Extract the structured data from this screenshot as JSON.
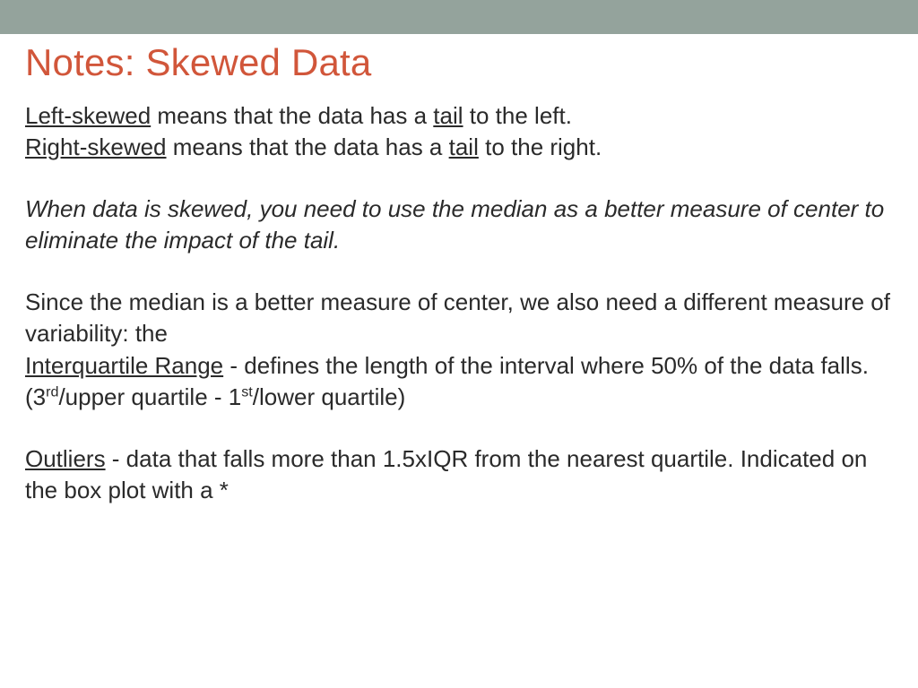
{
  "title": "Notes: Skewed Data",
  "p1": {
    "leftSkewed": "Left-skewed",
    "rest1": " means that the data has a ",
    "tail1": "tail",
    "rest2": " to the left."
  },
  "p2": {
    "rightSkewed": "Right-skewed",
    "rest1": " means that the data has a ",
    "tail2": "tail",
    "rest2": " to the right."
  },
  "p3": "When data is skewed, you need to use the median as a better measure of center to eliminate the impact of the tail.",
  "p4": "Since the median is a better measure of center, we also need a different measure of variability: the",
  "p5": {
    "iqr": "Interquartile Range",
    "rest1": " - defines the length of the interval where 50% of the data falls. (3",
    "sup1": "rd",
    "rest2": "/upper quartile - 1",
    "sup2": "st",
    "rest3": "/lower quartile)"
  },
  "p6": {
    "outliers": "Outliers",
    "rest": " - data that falls more than 1.5xIQR from the nearest quartile. Indicated on the box plot with a *"
  }
}
